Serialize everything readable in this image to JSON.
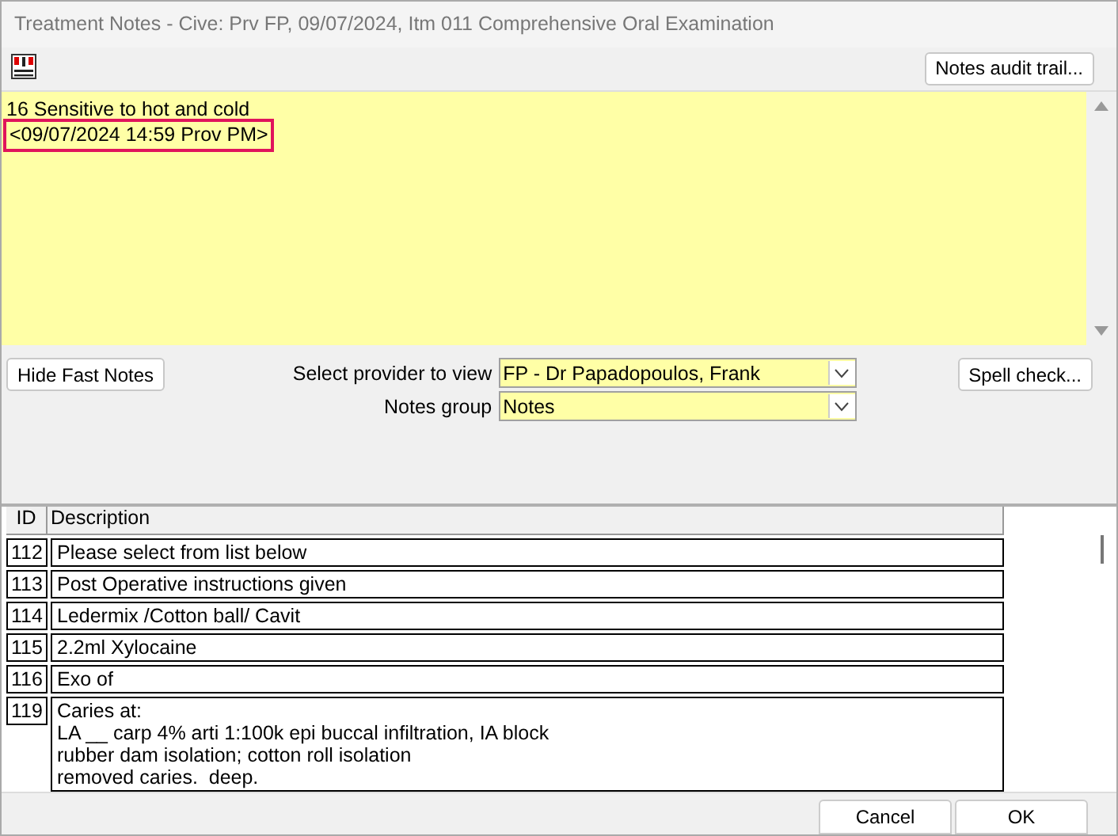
{
  "window": {
    "title": "Treatment Notes - Cive: Prv FP, 09/07/2024, Itm 011 Comprehensive Oral Examination"
  },
  "toolbar": {
    "audit_button": "Notes audit trail..."
  },
  "notes": {
    "lines": [
      {
        "text": "16 Sensitive to hot and cold",
        "highlighted": false
      },
      {
        "text": "<09/07/2024 14:59 Prov PM>",
        "highlighted": true
      }
    ]
  },
  "controls": {
    "hide_button": "Hide Fast Notes",
    "spell_button": "Spell check...",
    "fields": [
      {
        "label": "Select provider to view",
        "value": "FP - Dr Papadopoulos, Frank"
      },
      {
        "label": "Notes group",
        "value": "Notes"
      }
    ]
  },
  "table": {
    "columns": [
      "ID",
      "Description"
    ],
    "rows": [
      {
        "id": "112",
        "description": "Please select from list below"
      },
      {
        "id": "113",
        "description": "Post Operative instructions given"
      },
      {
        "id": "114",
        "description": "Ledermix /Cotton ball/ Cavit"
      },
      {
        "id": "115",
        "description": "2.2ml Xylocaine"
      },
      {
        "id": "116",
        "description": "Exo of"
      },
      {
        "id": "119",
        "description": "Caries at:\nLA __ carp 4% arti 1:100k epi buccal infiltration, IA block\nrubber dam isolation; cotton roll isolation\nremoved caries.  deep."
      }
    ]
  },
  "buttons": [
    "Cancel",
    "OK"
  ]
}
